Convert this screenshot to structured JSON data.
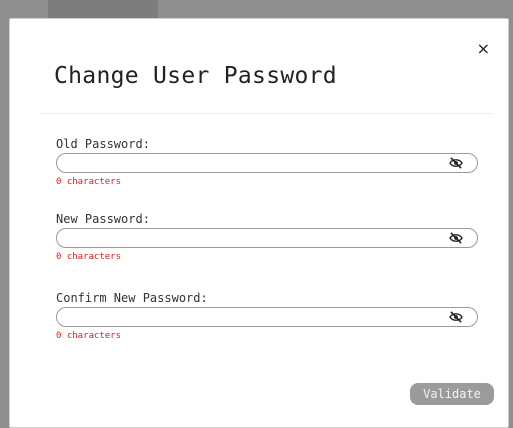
{
  "dialog": {
    "title": "Change User Password",
    "close_symbol": "×"
  },
  "fields": [
    {
      "label": "Old Password:",
      "value": "",
      "counter": "0 characters",
      "icon": "eye-slash-icon"
    },
    {
      "label": "New Password:",
      "value": "",
      "counter": "0 characters",
      "icon": "eye-slash-icon"
    },
    {
      "label": "Confirm New Password:",
      "value": "",
      "counter": "0 characters",
      "icon": "eye-slash-icon"
    }
  ],
  "actions": {
    "validate_label": "Validate"
  },
  "colors": {
    "counter_text": "#e02020",
    "validate_bg": "#9b9b9b",
    "overlay": "#8f8f8f"
  }
}
